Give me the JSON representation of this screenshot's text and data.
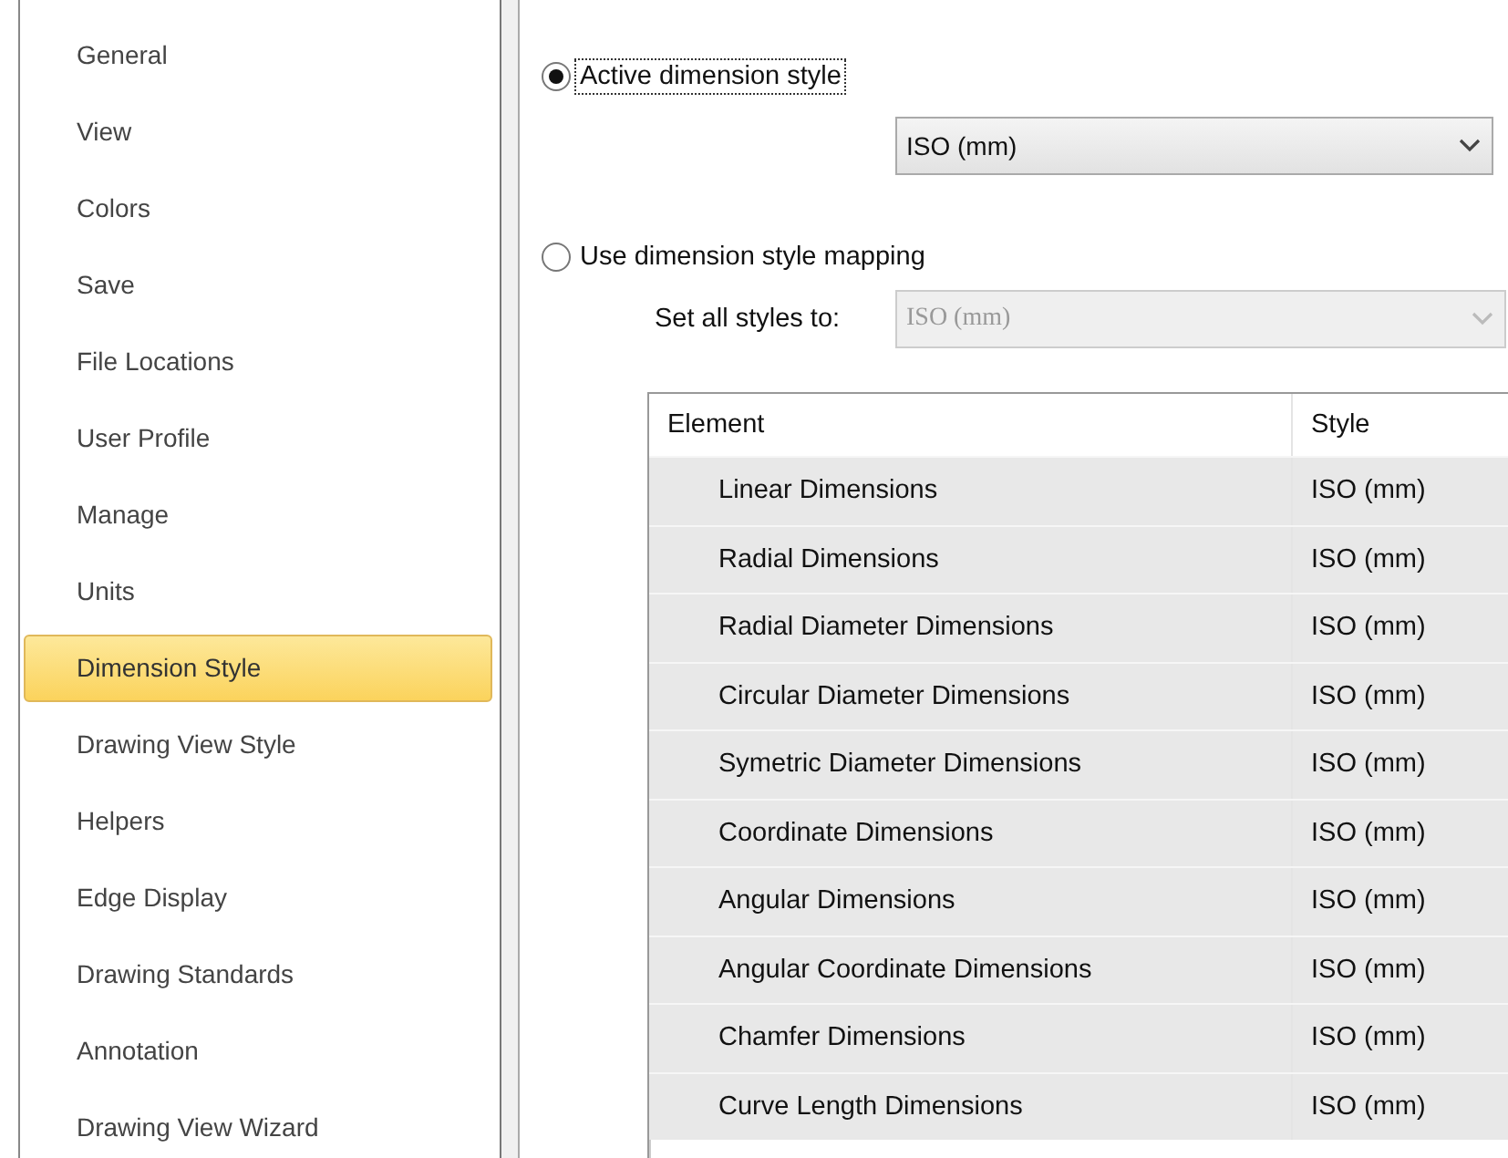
{
  "sidebar": {
    "items": [
      {
        "label": "General",
        "selected": false
      },
      {
        "label": "View",
        "selected": false
      },
      {
        "label": "Colors",
        "selected": false
      },
      {
        "label": "Save",
        "selected": false
      },
      {
        "label": "File Locations",
        "selected": false
      },
      {
        "label": "User Profile",
        "selected": false
      },
      {
        "label": "Manage",
        "selected": false
      },
      {
        "label": "Units",
        "selected": false
      },
      {
        "label": "Dimension Style",
        "selected": true
      },
      {
        "label": "Drawing View Style",
        "selected": false
      },
      {
        "label": "Helpers",
        "selected": false
      },
      {
        "label": "Edge Display",
        "selected": false
      },
      {
        "label": "Drawing Standards",
        "selected": false
      },
      {
        "label": "Annotation",
        "selected": false
      },
      {
        "label": "Drawing View Wizard",
        "selected": false
      }
    ]
  },
  "options": [
    {
      "label": "Active dimension style",
      "selected": true,
      "focused": true
    },
    {
      "label": "Use dimension style mapping",
      "selected": false,
      "focused": false
    }
  ],
  "active_style": {
    "value": "ISO (mm)",
    "disabled": false
  },
  "set_all": {
    "label": "Set all styles to:",
    "value": "ISO (mm)",
    "disabled": true
  },
  "table": {
    "columns": [
      "Element",
      "Style"
    ],
    "rows": [
      [
        "Linear Dimensions",
        "ISO (mm)"
      ],
      [
        "Radial Dimensions",
        "ISO (mm)"
      ],
      [
        "Radial Diameter Dimensions",
        "ISO (mm)"
      ],
      [
        "Circular Diameter Dimensions",
        "ISO (mm)"
      ],
      [
        "Symetric Diameter Dimensions",
        "ISO (mm)"
      ],
      [
        "Coordinate Dimensions",
        "ISO (mm)"
      ],
      [
        "Angular Dimensions",
        "ISO (mm)"
      ],
      [
        "Angular Coordinate Dimensions",
        "ISO (mm)"
      ],
      [
        "Chamfer Dimensions",
        "ISO (mm)"
      ],
      [
        "Curve Length Dimensions",
        "ISO (mm)"
      ]
    ]
  }
}
